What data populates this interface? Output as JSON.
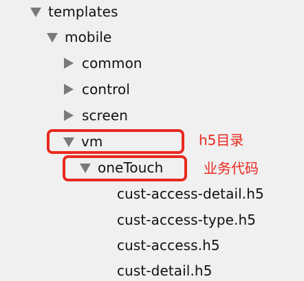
{
  "tree": {
    "templates": "templates",
    "mobile": "mobile",
    "common": "common",
    "control": "control",
    "screen": "screen",
    "vm": "vm",
    "oneTouch": "oneTouch",
    "files": [
      "cust-access-detail.h5",
      "cust-access-type.h5",
      "cust-access.h5",
      "cust-detail.h5"
    ]
  },
  "annotations": {
    "vm_note": "h5目录",
    "onetouch_note": "业务代码",
    "color": "#e8281e"
  },
  "icons": {
    "expanded": "triangle-down-icon",
    "collapsed": "triangle-right-icon"
  }
}
